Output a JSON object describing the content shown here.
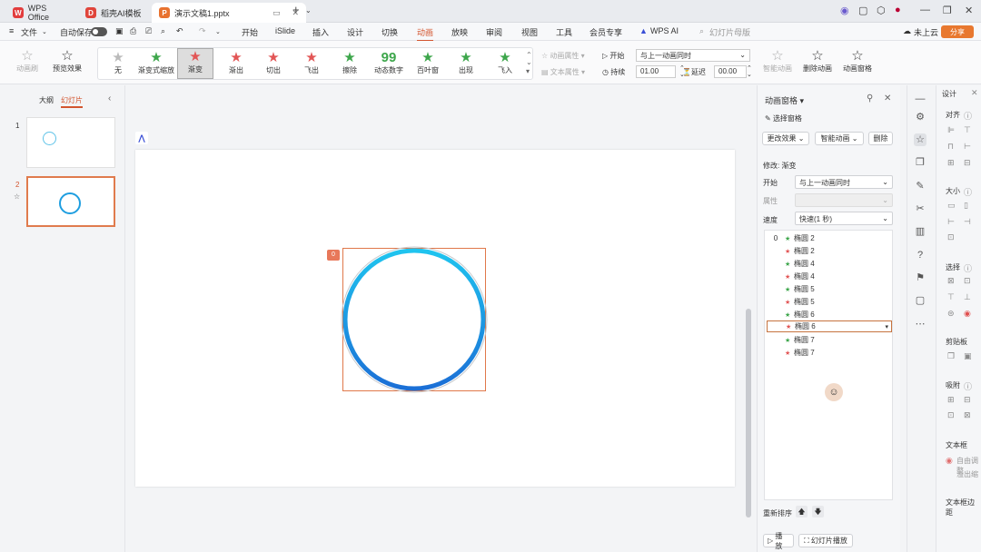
{
  "tabs": [
    {
      "label": "WPS Office"
    },
    {
      "label": "稻壳AI模板"
    },
    {
      "label": "演示文稿1.pptx"
    }
  ],
  "menubar": {
    "file": "文件",
    "autosave": "自动保存",
    "items": [
      "开始",
      "iSlide",
      "插入",
      "设计",
      "切换",
      "动画",
      "放映",
      "审阅",
      "视图",
      "工具",
      "会员专享"
    ],
    "wps_ai": "WPS AI",
    "search_placeholder": "幻灯片母版",
    "cloud": "未上云",
    "share": "分享"
  },
  "ribbon": {
    "brush": "动画刷",
    "preview": "预览效果",
    "effects": [
      "无",
      "渐变式缩放",
      "渐变",
      "渐出",
      "切出",
      "飞出",
      "擦除",
      "动态数字",
      "百叶窗",
      "出现",
      "飞入"
    ],
    "anim_attr": "动画属性",
    "text_attr": "文本属性",
    "start_label": "开始",
    "start_value": "与上一动画同时",
    "duration_label": "持续",
    "duration_value": "01.00",
    "delay_label": "延迟",
    "delay_value": "00.00",
    "smart_anim": "智能动画",
    "delete_anim": "删除动画",
    "anim_pane": "动画窗格"
  },
  "leftpanel": {
    "outline": "大纲",
    "slides": "幻灯片",
    "slide_numbers": [
      "1",
      "2"
    ]
  },
  "canvas": {
    "tag": "0"
  },
  "animpane": {
    "title": "动画窗格",
    "select_pane": "选择窗格",
    "change_effect": "更改效果",
    "smart_anim": "智能动画",
    "delete": "删除",
    "modify": "修改: 渐变",
    "start_label": "开始",
    "start_value": "与上一动画同时",
    "attr_label": "属性",
    "speed_label": "速度",
    "speed_value": "快速(1 秒)",
    "items": [
      {
        "num": "0",
        "name": "椭圆 2"
      },
      {
        "num": "",
        "name": "椭圆 2"
      },
      {
        "num": "",
        "name": "椭圆 4"
      },
      {
        "num": "",
        "name": "椭圆 4"
      },
      {
        "num": "",
        "name": "椭圆 5"
      },
      {
        "num": "",
        "name": "椭圆 5"
      },
      {
        "num": "",
        "name": "椭圆 6"
      },
      {
        "num": "",
        "name": "椭圆 6"
      },
      {
        "num": "",
        "name": "椭圆 7"
      },
      {
        "num": "",
        "name": "椭圆 7"
      }
    ],
    "reorder": "重新排序",
    "play": "播放",
    "slideshow": "幻灯片播放"
  },
  "designpanel": {
    "title": "设计",
    "align": "对齐",
    "size": "大小",
    "select": "选择",
    "clipboard": "剪贴板",
    "snap": "吸附",
    "textbox": "文本框",
    "autofit": "自由调整",
    "overflow": "溢出缩",
    "margin": "文本框边距"
  },
  "colors": {
    "accent": "#d3552f",
    "selection": "#e07b4d",
    "circle_top": "#1fc4ef",
    "circle_bottom": "#1b6fd6"
  }
}
